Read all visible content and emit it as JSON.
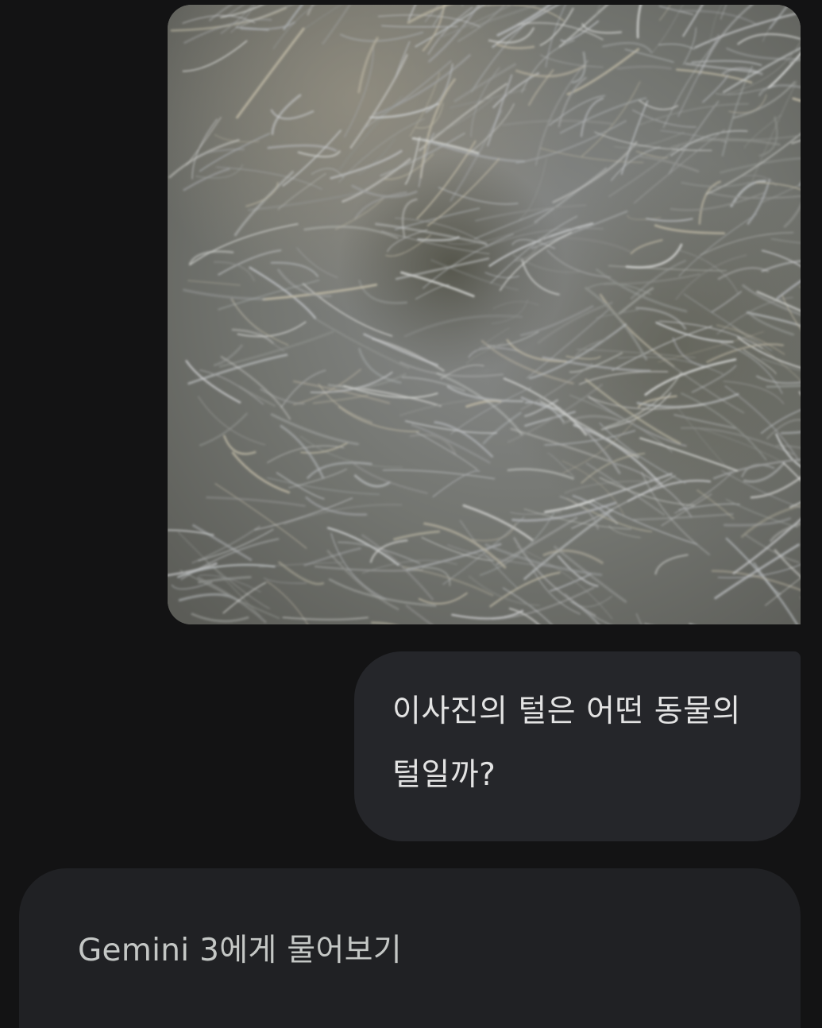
{
  "conversation": {
    "user_image": {
      "description_icon": "photo-icon"
    },
    "user_message": "이사진의 털은 어떤 동물의 털일까?"
  },
  "composer": {
    "placeholder": "Gemini 3에게 물어보기"
  }
}
